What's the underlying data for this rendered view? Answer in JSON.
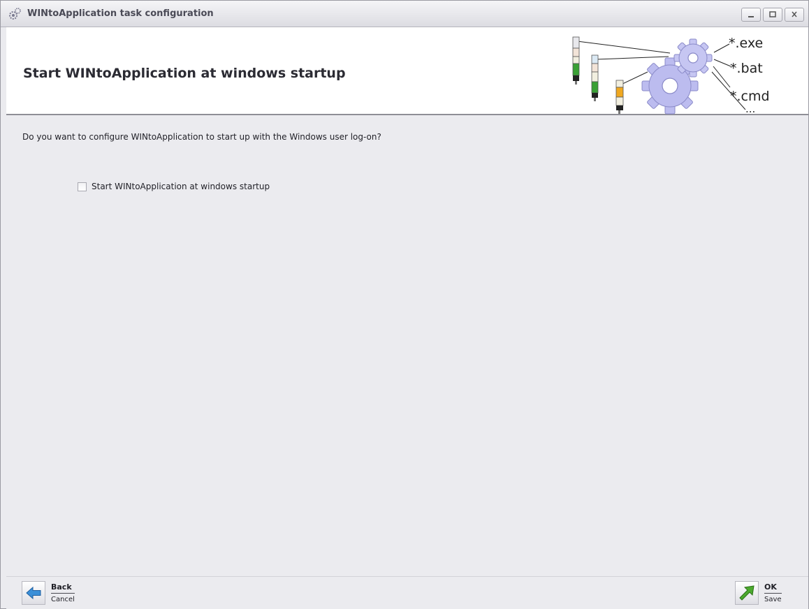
{
  "window": {
    "title": "WINtoApplication task configuration",
    "buttons": {
      "minimize": "_",
      "maximize": "□",
      "close": "x"
    }
  },
  "header": {
    "title": "Start WINtoApplication at windows startup",
    "extensions": [
      "*.exe",
      "*.bat",
      "*.cmd",
      "..."
    ]
  },
  "content": {
    "question": "Do you want to configure WINtoApplication to start up with the Windows user log-on?",
    "startup_checkbox": {
      "label": "Start WINtoApplication at windows startup",
      "checked": false
    }
  },
  "footer": {
    "back": {
      "label": "Back",
      "sub_label": "Cancel",
      "icon": "arrow-left-icon"
    },
    "ok": {
      "label": "OK",
      "sub_label": "Save",
      "icon": "arrow-up-right-icon"
    }
  },
  "colors": {
    "accent_blue": "#3a8fd8",
    "accent_green": "#4caa2e",
    "gear": "#b8b8ec"
  }
}
